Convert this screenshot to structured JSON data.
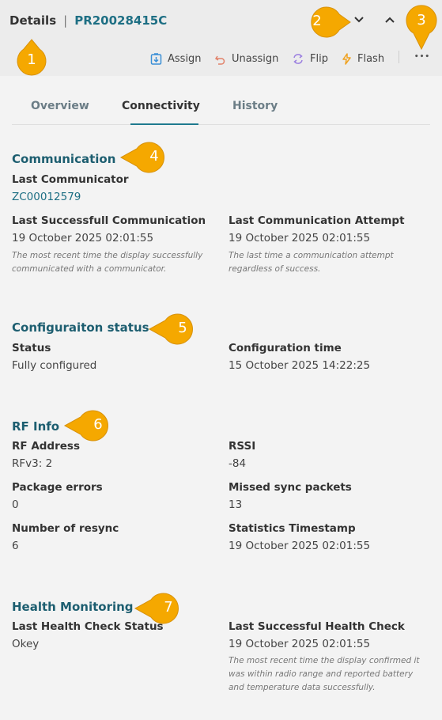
{
  "header": {
    "title": "Details",
    "separator": "|",
    "record_id": "PR20028415C"
  },
  "toolbar": {
    "assign": "Assign",
    "unassign": "Unassign",
    "flip": "Flip",
    "flash": "Flash",
    "more": "•••"
  },
  "tabs": [
    {
      "label": "Overview",
      "active": false
    },
    {
      "label": "Connectivity",
      "active": true
    },
    {
      "label": "History",
      "active": false
    }
  ],
  "communication": {
    "title": "Communication",
    "last_communicator_label": "Last Communicator",
    "last_communicator_value": "ZC00012579",
    "last_success_label": "Last Successfull Communication",
    "last_success_value": "19 October 2025 02:01:55",
    "last_success_hint_1": "The most recent time the display successfully",
    "last_success_hint_2": "communicated with a communicator.",
    "last_attempt_label": "Last Communication Attempt",
    "last_attempt_value": "19 October 2025 02:01:55",
    "last_attempt_hint_1": "The last time a communication attempt",
    "last_attempt_hint_2": "regardless of success."
  },
  "configuration": {
    "title": "Configuraiton status",
    "status_label": "Status",
    "status_value": "Fully configured",
    "time_label": "Configuration time",
    "time_value": "15 October 2025 14:22:25"
  },
  "rf_info": {
    "title": "RF Info",
    "rf_address_label": "RF Address",
    "rf_address_value": "RFv3: 2",
    "rssi_label": "RSSI",
    "rssi_value": "-84",
    "package_errors_label": "Package errors",
    "package_errors_value": "0",
    "missed_sync_label": "Missed sync packets",
    "missed_sync_value": "13",
    "resync_label": "Number of resync",
    "resync_value": "6",
    "stats_ts_label": "Statistics Timestamp",
    "stats_ts_value": "19 October 2025 02:01:55"
  },
  "health": {
    "title": "Health Monitoring",
    "status_label": "Last Health Check Status",
    "status_value": "Okey",
    "success_label": "Last Successful Health Check",
    "success_value": "19 October 2025 02:01:55",
    "hint_1": "The most recent time the display confirmed it",
    "hint_2": "was within radio range and reported battery",
    "hint_3": "and temperature data successfully."
  },
  "callouts": [
    "1",
    "2",
    "3",
    "4",
    "5",
    "6",
    "7"
  ],
  "colors": {
    "accent": "#1e6f84",
    "callout": "#f5a800",
    "background": "#f3f3f3"
  }
}
